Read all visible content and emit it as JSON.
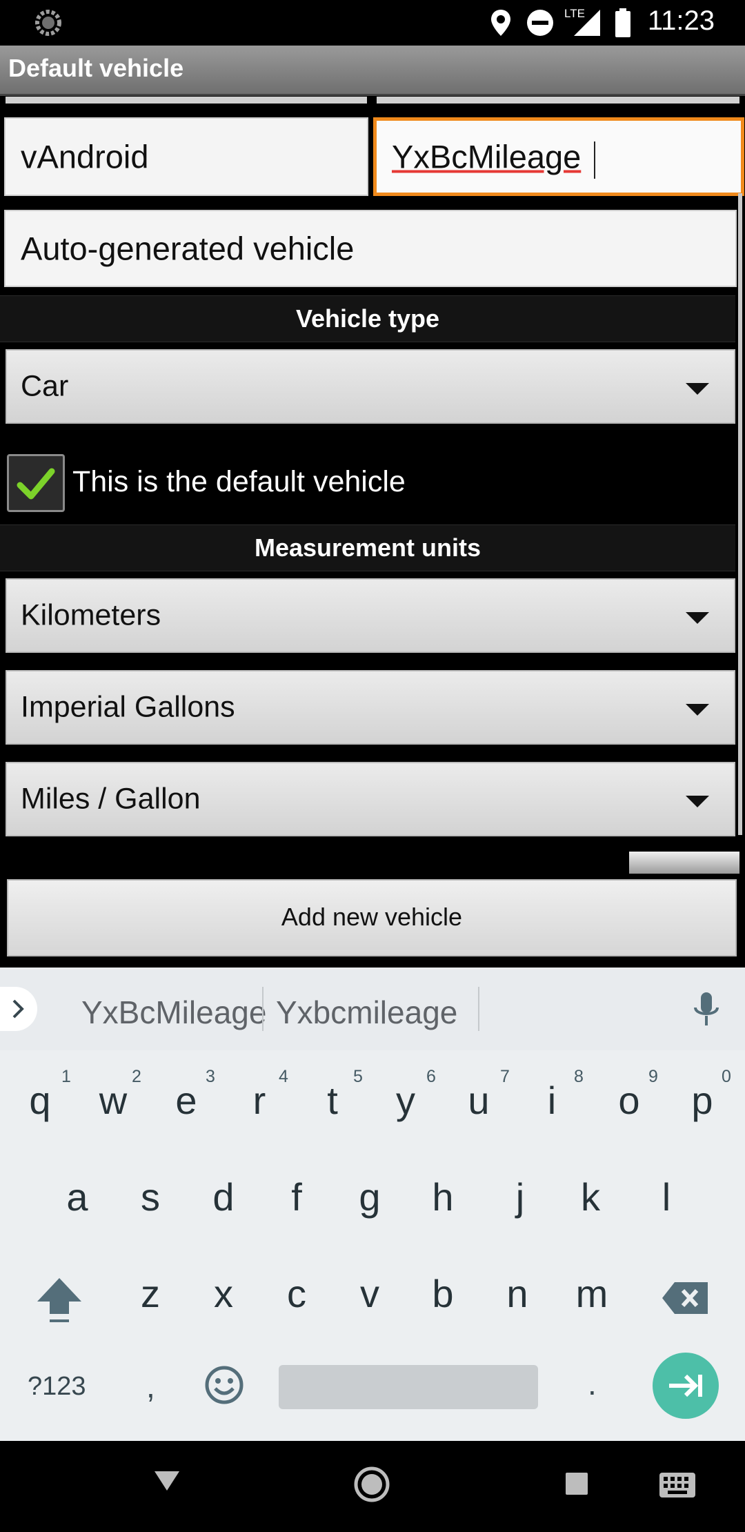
{
  "status_bar": {
    "time": "11:23",
    "network": "LTE"
  },
  "app_bar": {
    "title": "Default vehicle"
  },
  "form": {
    "name_value": "vAndroid",
    "make_value": "YxBcMileage",
    "description_value": "Auto-generated vehicle",
    "vehicle_type_header": "Vehicle type",
    "vehicle_type_selected": "Car",
    "default_checkbox_label": "This is the default vehicle",
    "default_checked": true,
    "units_header": "Measurement units",
    "distance_unit": "Kilometers",
    "volume_unit": "Imperial Gallons",
    "economy_unit": "Miles / Gallon",
    "add_button_label": "Add new vehicle"
  },
  "keyboard": {
    "suggestions": [
      "YxBcMileage",
      "Yxbcmileage"
    ],
    "row1": [
      "q",
      "w",
      "e",
      "r",
      "t",
      "y",
      "u",
      "i",
      "o",
      "p"
    ],
    "row1_hints": [
      "1",
      "2",
      "3",
      "4",
      "5",
      "6",
      "7",
      "8",
      "9",
      "0"
    ],
    "row2": [
      "a",
      "s",
      "d",
      "f",
      "g",
      "h",
      "j",
      "k",
      "l"
    ],
    "row3": [
      "z",
      "x",
      "c",
      "v",
      "b",
      "n",
      "m"
    ],
    "symbols_key": "?123",
    "comma_key": ",",
    "period_key": "."
  },
  "colors": {
    "focus": "#f08a1c",
    "check": "#7cd22a",
    "enter_key": "#4dbfa8"
  }
}
